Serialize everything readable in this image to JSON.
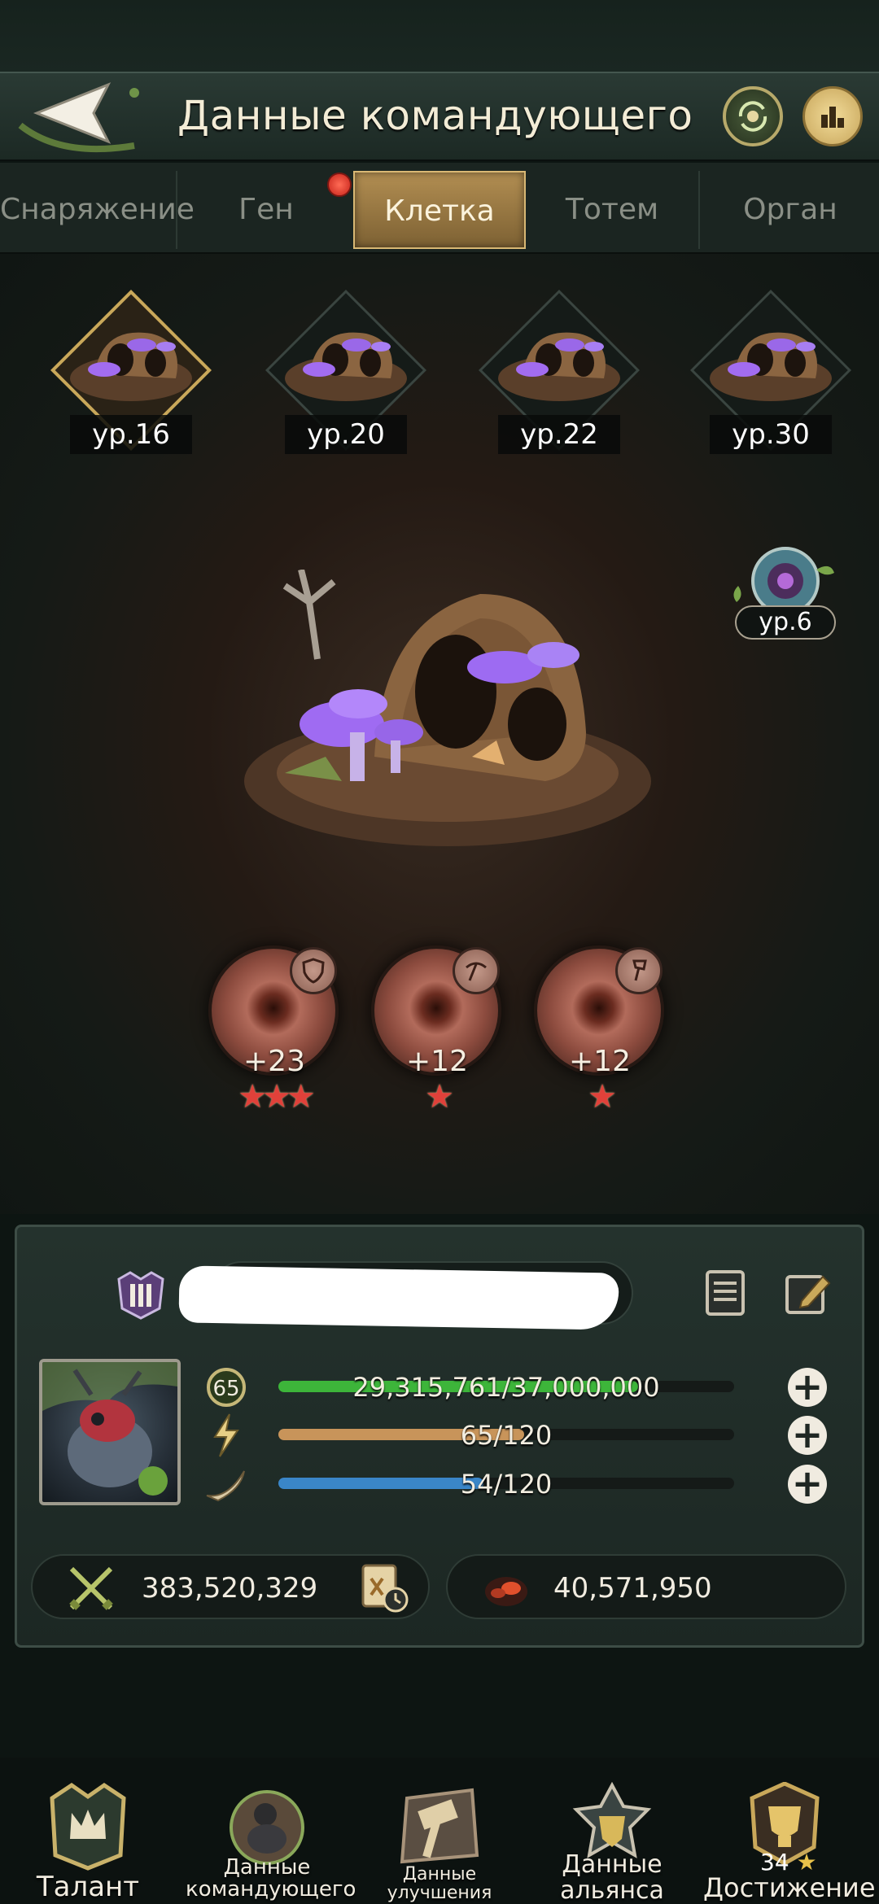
{
  "header": {
    "title": "Данные командующего",
    "back_icon": "back-arrow-icon",
    "swap_icon": "commander-swap-icon",
    "rank_icon": "ranking-chart-icon"
  },
  "tabs": [
    {
      "label": "Снаряжение"
    },
    {
      "label": "Ген"
    },
    {
      "label": "Клетка"
    },
    {
      "label": "Тотем"
    },
    {
      "label": "Орган"
    }
  ],
  "active_tab": "Клетка",
  "cells": [
    {
      "level": "ур.16"
    },
    {
      "level": "ур.20"
    },
    {
      "level": "ур.22"
    },
    {
      "level": "ур.30"
    }
  ],
  "side_badge": {
    "level": "ур.6"
  },
  "orbs": [
    {
      "bonus": "+23",
      "stars": "★★★",
      "icon": "shield-icon"
    },
    {
      "bonus": "+12",
      "stars": "★",
      "icon": "pickaxe-icon"
    },
    {
      "bonus": "+12",
      "stars": "★",
      "icon": "axe-icon"
    }
  ],
  "commander": {
    "level": "65",
    "exp": "29,315,761/37,000,000",
    "exp_ratio": 0.79,
    "energy": "65/120",
    "energy_ratio": 0.54,
    "stamina": "54/120",
    "stamina_ratio": 0.45,
    "power": "383,520,329",
    "kills": "40,571,950"
  },
  "colors": {
    "exp_bar": "#3db53a",
    "energy_bar": "#c8945a",
    "stamina_bar": "#3a86c8",
    "accent_gold": "#c9a85a"
  },
  "nav": [
    {
      "label": "Талант"
    },
    {
      "label": "Данные командующего"
    },
    {
      "label": "Данные улучшения командующего"
    },
    {
      "label": "Данные альянса"
    },
    {
      "label": "Достижение",
      "count": "34"
    }
  ]
}
